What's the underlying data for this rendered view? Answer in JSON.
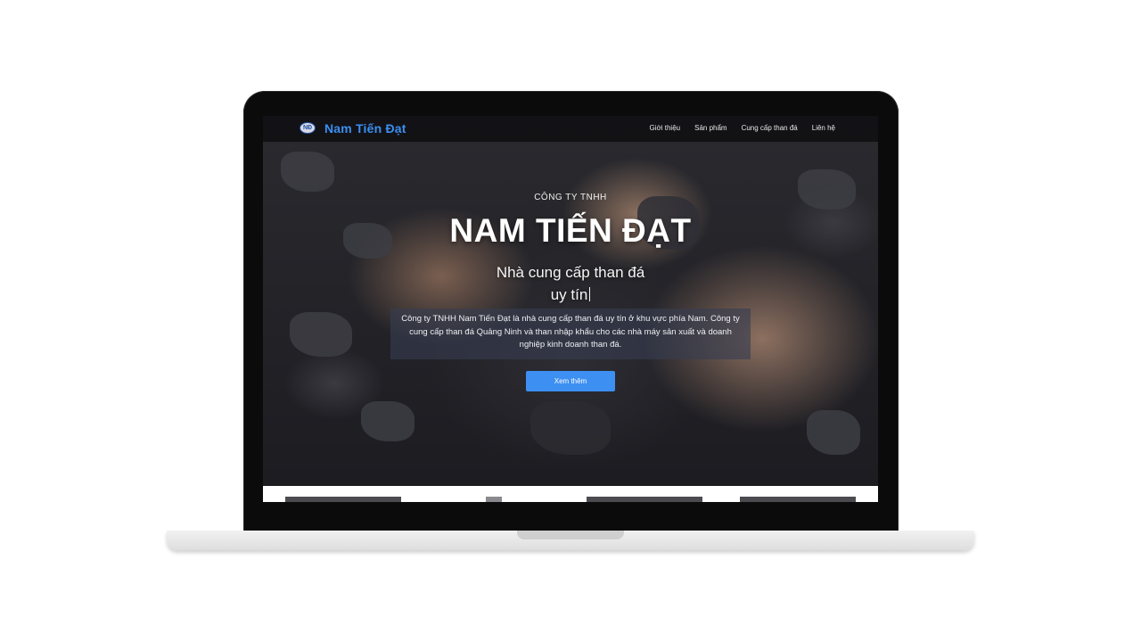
{
  "site": {
    "brand": "Nam Tiến Đạt",
    "logo_text": "NĐ",
    "nav": [
      {
        "label": "Giới thiệu"
      },
      {
        "label": "Sản phẩm"
      },
      {
        "label": "Cung cấp than đá"
      },
      {
        "label": "Liên hệ"
      }
    ]
  },
  "hero": {
    "eyebrow": "CÔNG TY TNHH",
    "title": "NAM TIẾN ĐẠT",
    "tagline_line1": "Nhà cung cấp than đá",
    "tagline_line2": "uy tín",
    "description": "Công ty TNHH Nam Tiến Đạt là nhà cung cấp than đá uy tín ở khu vực phía Nam. Công ty cung cấp than đá Quảng Ninh và than nhập khẩu cho các nhà máy sản xuất và doanh nghiệp kinh doanh than đá.",
    "cta_label": "Xem thêm"
  },
  "colors": {
    "accent": "#3d8ff2",
    "brand_text": "#3b8ff0",
    "nav_background": "#0a0a0c"
  }
}
